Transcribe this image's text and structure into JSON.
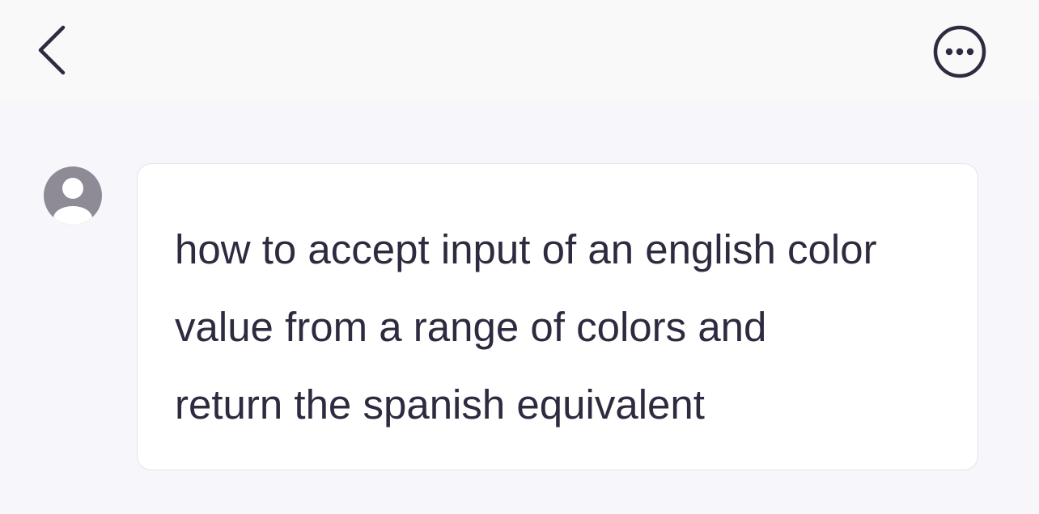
{
  "header": {
    "back_icon": "chevron-left-icon",
    "more_icon": "ellipsis-circle-icon"
  },
  "conversation": {
    "user_avatar_icon": "user-avatar-icon",
    "message": {
      "text": "how to accept input of an english color\nvalue from a range of colors and\nreturn the spanish equivalent"
    }
  },
  "colors": {
    "header_bg": "#f9f9fa",
    "content_bg": "#f7f7fb",
    "icon_dark": "#2d2b3f",
    "avatar_gray": "#8e8a96",
    "bubble_bg": "#ffffff",
    "bubble_border": "#e3e3e8"
  }
}
